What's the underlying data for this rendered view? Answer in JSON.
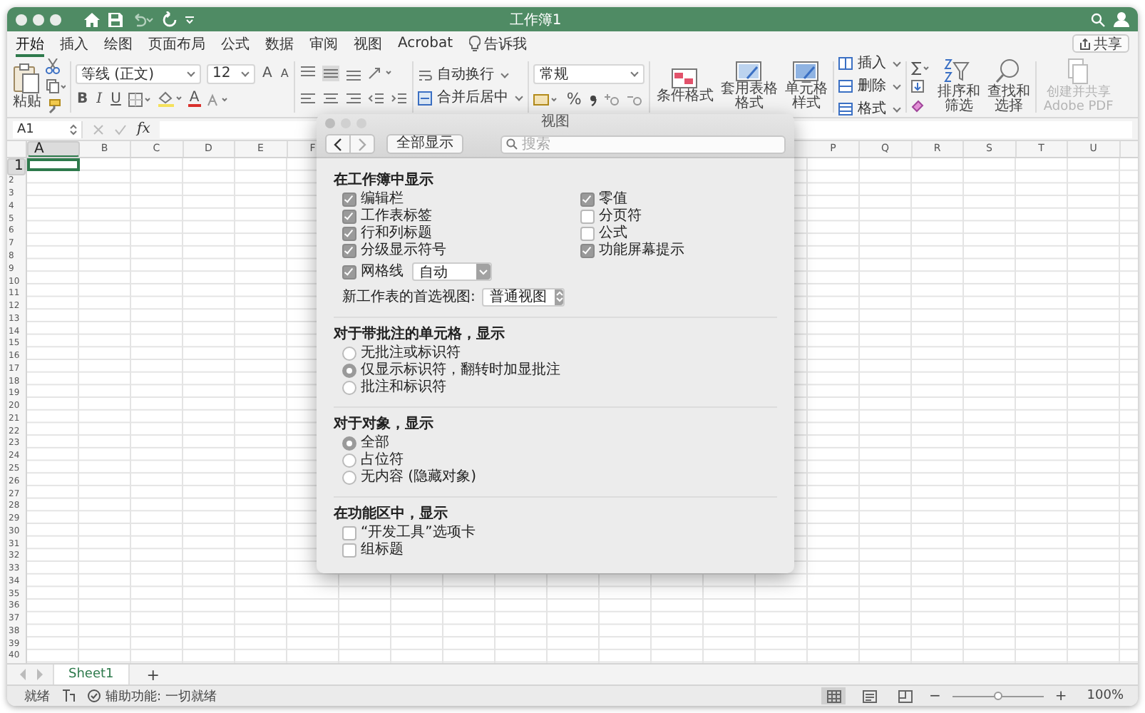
{
  "window": {
    "title": "工作簿1"
  },
  "tabs": [
    {
      "label": "开始",
      "selected": true
    },
    {
      "label": "插入",
      "selected": false
    },
    {
      "label": "绘图",
      "selected": false
    },
    {
      "label": "页面布局",
      "selected": false
    },
    {
      "label": "公式",
      "selected": false
    },
    {
      "label": "数据",
      "selected": false
    },
    {
      "label": "审阅",
      "selected": false
    },
    {
      "label": "视图",
      "selected": false
    },
    {
      "label": "Acrobat",
      "selected": false
    }
  ],
  "tell_me": "告诉我",
  "share": "共享",
  "ribbon": {
    "paste": "粘贴",
    "font": "等线 (正文)",
    "size": "12",
    "grow": "A",
    "shrink": "A",
    "styles": [
      "B",
      "I",
      "U"
    ],
    "font_color": "A",
    "wrap": "自动换行",
    "merge": "合并后居中",
    "number_format": "常规",
    "percent": "%",
    "style_buttons": [
      "条件格式",
      "套用表格格式",
      "单元格样式"
    ],
    "cells": [
      "插入",
      "删除",
      "格式"
    ],
    "sort": "排序和筛选",
    "find": "查找和选择",
    "pdf": {
      "label": "创建并共享 Adobe PDF",
      "disabled": true
    }
  },
  "formula_bar": {
    "name_box": "A1",
    "fx": "fx"
  },
  "grid": {
    "columns_left": [
      {
        "label": "A",
        "selected": true
      },
      {
        "label": "B",
        "selected": false
      },
      {
        "label": "C",
        "selected": false
      },
      {
        "label": "D",
        "selected": false
      },
      {
        "label": "E",
        "selected": false
      },
      {
        "label": "F",
        "selected": false
      }
    ],
    "columns_right": [
      {
        "label": "P",
        "selected": false
      },
      {
        "label": "Q",
        "selected": false
      },
      {
        "label": "R",
        "selected": false
      },
      {
        "label": "S",
        "selected": false
      },
      {
        "label": "T",
        "selected": false
      },
      {
        "label": "U",
        "selected": false
      }
    ],
    "rows": [
      {
        "label": "1",
        "selected": true
      },
      {
        "label": "2",
        "selected": false
      },
      {
        "label": "3",
        "selected": false
      },
      {
        "label": "4",
        "selected": false
      },
      {
        "label": "5",
        "selected": false
      },
      {
        "label": "6",
        "selected": false
      },
      {
        "label": "7",
        "selected": false
      },
      {
        "label": "8",
        "selected": false
      },
      {
        "label": "9",
        "selected": false
      },
      {
        "label": "10",
        "selected": false
      },
      {
        "label": "11",
        "selected": false
      },
      {
        "label": "12",
        "selected": false
      },
      {
        "label": "13",
        "selected": false
      },
      {
        "label": "14",
        "selected": false
      },
      {
        "label": "15",
        "selected": false
      },
      {
        "label": "16",
        "selected": false
      },
      {
        "label": "17",
        "selected": false
      },
      {
        "label": "18",
        "selected": false
      },
      {
        "label": "19",
        "selected": false
      },
      {
        "label": "20",
        "selected": false
      },
      {
        "label": "21",
        "selected": false
      },
      {
        "label": "22",
        "selected": false
      },
      {
        "label": "23",
        "selected": false
      },
      {
        "label": "24",
        "selected": false
      },
      {
        "label": "25",
        "selected": false
      },
      {
        "label": "26",
        "selected": false
      },
      {
        "label": "27",
        "selected": false
      },
      {
        "label": "28",
        "selected": false
      },
      {
        "label": "29",
        "selected": false
      },
      {
        "label": "30",
        "selected": false
      },
      {
        "label": "31",
        "selected": false
      },
      {
        "label": "32",
        "selected": false
      },
      {
        "label": "33",
        "selected": false
      },
      {
        "label": "34",
        "selected": false
      },
      {
        "label": "35",
        "selected": false
      },
      {
        "label": "36",
        "selected": false
      },
      {
        "label": "37",
        "selected": false
      },
      {
        "label": "38",
        "selected": false
      },
      {
        "label": "39",
        "selected": false
      },
      {
        "label": "40",
        "selected": false
      }
    ]
  },
  "sheets": [
    {
      "label": "Sheet1",
      "selected": true
    }
  ],
  "add_sheet": "+",
  "status": {
    "ready": "就绪",
    "accessibility": "辅助功能: 一切就绪",
    "views": [
      {
        "kind": "normal",
        "selected": true
      },
      {
        "kind": "page_layout",
        "selected": false
      },
      {
        "kind": "page_break",
        "selected": false
      }
    ],
    "zoom": {
      "minus": "−",
      "plus": "+",
      "level": 0.5,
      "reading": "100%"
    }
  },
  "dialog": {
    "title": "视图",
    "show_all": "全部显示",
    "search": {
      "placeholder": "搜索"
    },
    "sections": [
      {
        "kind": "workbook",
        "title": "在工作簿中显示",
        "left": [
          {
            "label": "编辑栏",
            "checked": true
          },
          {
            "label": "工作表标签",
            "checked": true
          },
          {
            "label": "行和列标题",
            "checked": true
          },
          {
            "label": "分级显示符号",
            "checked": true
          }
        ],
        "right": [
          {
            "label": "零值",
            "checked": true
          },
          {
            "label": "分页符",
            "checked": false
          },
          {
            "label": "公式",
            "checked": false
          },
          {
            "label": "功能屏幕提示",
            "checked": true
          }
        ],
        "gridlines": {
          "label": "网格线",
          "checked": true,
          "color_option": "自动"
        },
        "view_pref": {
          "label": "新工作表的首选视图:",
          "value": "普通视图"
        }
      },
      {
        "kind": "radios",
        "title": "对于带批注的单元格，显示",
        "items": [
          {
            "label": "无批注或标识符",
            "selected": false
          },
          {
            "label": "仅显示标识符，翻转时加显批注",
            "selected": true
          },
          {
            "label": "批注和标识符",
            "selected": false
          }
        ]
      },
      {
        "kind": "radios",
        "title": "对于对象，显示",
        "items": [
          {
            "label": "全部",
            "selected": true
          },
          {
            "label": "占位符",
            "selected": false
          },
          {
            "label": "无内容 (隐藏对象)",
            "selected": false
          }
        ]
      },
      {
        "kind": "checks",
        "title": "在功能区中，显示",
        "items": [
          {
            "label": "“开发工具”选项卡",
            "checked": false
          },
          {
            "label": "组标题",
            "checked": false
          }
        ]
      }
    ]
  }
}
